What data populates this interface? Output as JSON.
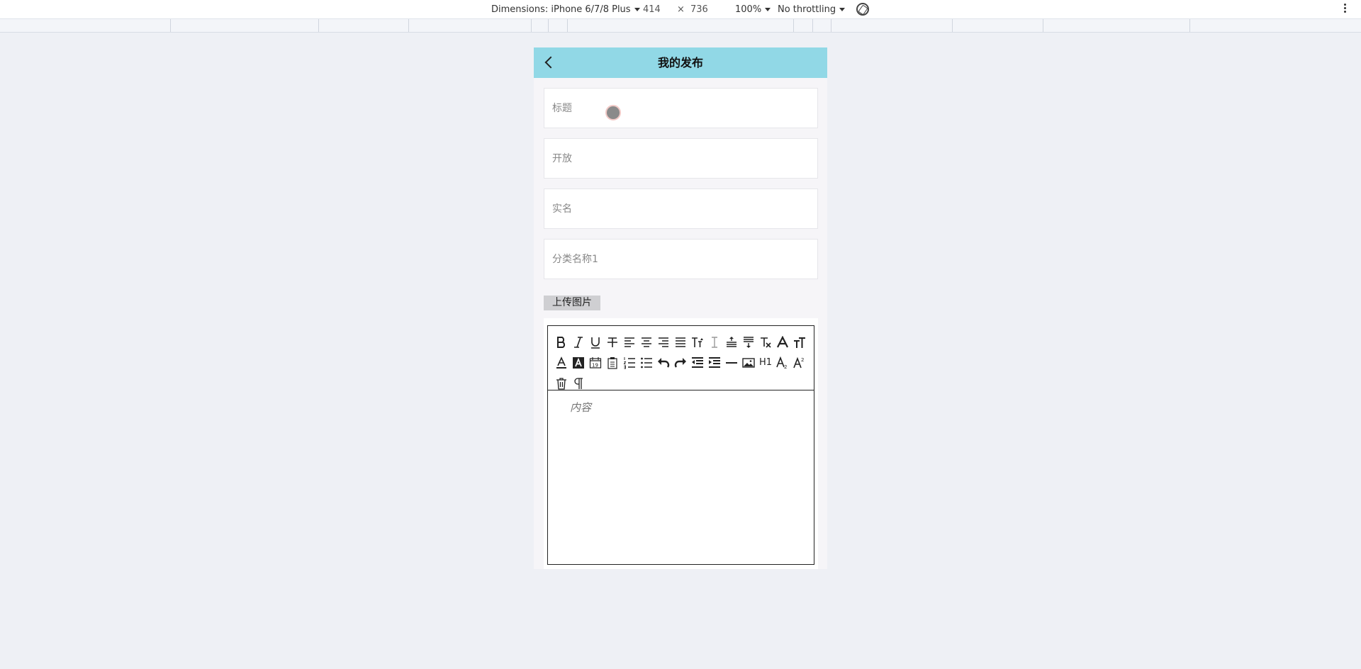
{
  "devtools": {
    "dimensions_label": "Dimensions: iPhone 6/7/8 Plus",
    "width_value": "414",
    "times": "×",
    "height_value": "736",
    "zoom": "100%",
    "throttling": "No throttling"
  },
  "header": {
    "title": "我的发布"
  },
  "form": {
    "title_placeholder": "标题",
    "open_placeholder": "开放",
    "realname_placeholder": "实名",
    "category_placeholder": "分类名称1",
    "upload_label": "上传图片",
    "content_placeholder": "内容"
  },
  "toolbar": {
    "row1": [
      "bold-icon",
      "italic-icon",
      "underline-icon",
      "strikethrough-icon",
      "align-left-icon",
      "align-center-icon",
      "align-right-icon",
      "align-justify-icon",
      "font-size-icon",
      "line-height-icon",
      "indent-top-icon",
      "indent-bottom-icon",
      "clear-format-icon",
      "font-family-icon",
      "text-height-icon"
    ],
    "row2": [
      "font-color-icon",
      "background-color-icon",
      "date-icon",
      "paste-icon",
      "ordered-list-icon",
      "unordered-list-icon",
      "undo-icon",
      "redo-icon",
      "outdent-icon",
      "indent-icon",
      "horizontal-rule-icon",
      "image-icon",
      "heading-icon",
      "subscript-icon",
      "superscript-icon"
    ],
    "row3": [
      "delete-icon",
      "paragraph-icon"
    ],
    "heading_text": "H1"
  },
  "colors": {
    "header_bg": "#91d8e6",
    "page_bg": "#eef0f5"
  }
}
